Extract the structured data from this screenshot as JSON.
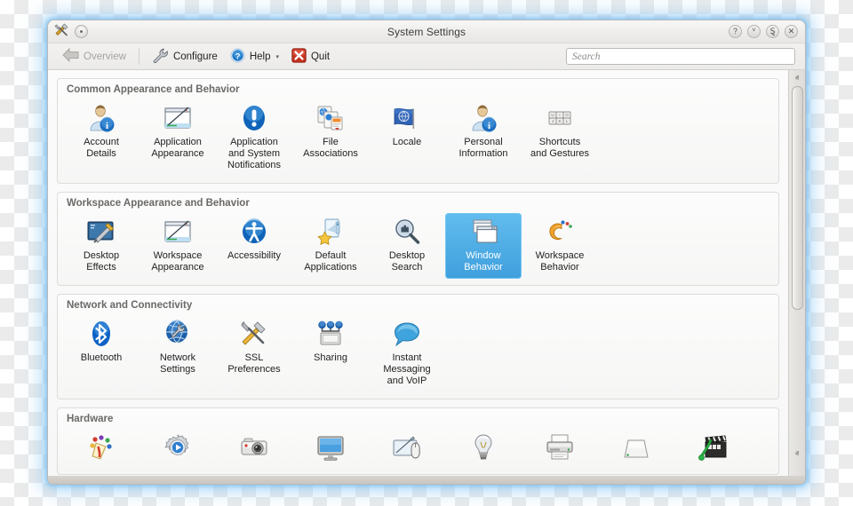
{
  "window": {
    "title": "System Settings",
    "app_icon": "tools-icon",
    "app_menu_icon": "app-menu-icon",
    "controls": [
      {
        "name": "help",
        "glyph": "?"
      },
      {
        "name": "minimize",
        "glyph": "ⱽ"
      },
      {
        "name": "maximize",
        "glyph": "Ȿ"
      },
      {
        "name": "close",
        "glyph": "✕"
      }
    ]
  },
  "toolbar": {
    "overview_label": "Overview",
    "configure_label": "Configure",
    "help_label": "Help",
    "quit_label": "Quit",
    "help_caret": "▾"
  },
  "search": {
    "placeholder": "Search",
    "value": ""
  },
  "scrollbar": {
    "up_glyph": "ⱏ",
    "down_glyph": "ⱟ",
    "thumb_top_percent": 0,
    "thumb_height_percent": 62
  },
  "groups": [
    {
      "title": "Common Appearance and Behavior",
      "items": [
        {
          "label": "Account\nDetails",
          "icon": "user-details-icon",
          "selected": false
        },
        {
          "label": "Application\nAppearance",
          "icon": "application-appearance-icon",
          "selected": false
        },
        {
          "label": "Application\nand System\nNotifications",
          "icon": "notifications-icon",
          "selected": false
        },
        {
          "label": "File\nAssociations",
          "icon": "file-associations-icon",
          "selected": false
        },
        {
          "label": "Locale",
          "icon": "locale-flag-icon",
          "selected": false
        },
        {
          "label": "Personal\nInformation",
          "icon": "personal-information-icon",
          "selected": false
        },
        {
          "label": "Shortcuts\nand Gestures",
          "icon": "keyboard-shortcuts-icon",
          "selected": false
        }
      ]
    },
    {
      "title": "Workspace Appearance and Behavior",
      "items": [
        {
          "label": "Desktop\nEffects",
          "icon": "desktop-effects-icon",
          "selected": false
        },
        {
          "label": "Workspace\nAppearance",
          "icon": "workspace-appearance-icon",
          "selected": false
        },
        {
          "label": "Accessibility",
          "icon": "accessibility-icon",
          "selected": false
        },
        {
          "label": "Default\nApplications",
          "icon": "default-applications-icon",
          "selected": false
        },
        {
          "label": "Desktop\nSearch",
          "icon": "desktop-search-icon",
          "selected": false
        },
        {
          "label": "Window\nBehavior",
          "icon": "window-behavior-icon",
          "selected": true
        },
        {
          "label": "Workspace\nBehavior",
          "icon": "workspace-behavior-icon",
          "selected": false
        }
      ]
    },
    {
      "title": "Network and Connectivity",
      "items": [
        {
          "label": "Bluetooth",
          "icon": "bluetooth-icon",
          "selected": false
        },
        {
          "label": "Network\nSettings",
          "icon": "network-settings-icon",
          "selected": false
        },
        {
          "label": "SSL\nPreferences",
          "icon": "ssl-preferences-icon",
          "selected": false
        },
        {
          "label": "Sharing",
          "icon": "sharing-icon",
          "selected": false
        },
        {
          "label": "Instant\nMessaging\nand VoIP",
          "icon": "instant-messaging-icon",
          "selected": false
        }
      ]
    },
    {
      "title": "Hardware",
      "items": [
        {
          "label": "",
          "icon": "color-picker-icon",
          "selected": false
        },
        {
          "label": "",
          "icon": "multimedia-gear-icon",
          "selected": false
        },
        {
          "label": "",
          "icon": "digital-camera-icon",
          "selected": false
        },
        {
          "label": "",
          "icon": "display-monitor-icon",
          "selected": false
        },
        {
          "label": "",
          "icon": "input-devices-icon",
          "selected": false
        },
        {
          "label": "",
          "icon": "power-lightbulb-icon",
          "selected": false
        },
        {
          "label": "",
          "icon": "printer-icon",
          "selected": false
        },
        {
          "label": "",
          "icon": "removable-drive-icon",
          "selected": false
        },
        {
          "label": "",
          "icon": "multimedia-clapper-icon",
          "selected": false
        }
      ]
    }
  ],
  "colors": {
    "selection": "#4aa8e2",
    "window_glow": "#8cc8f5",
    "group_title": "#6b6966"
  }
}
